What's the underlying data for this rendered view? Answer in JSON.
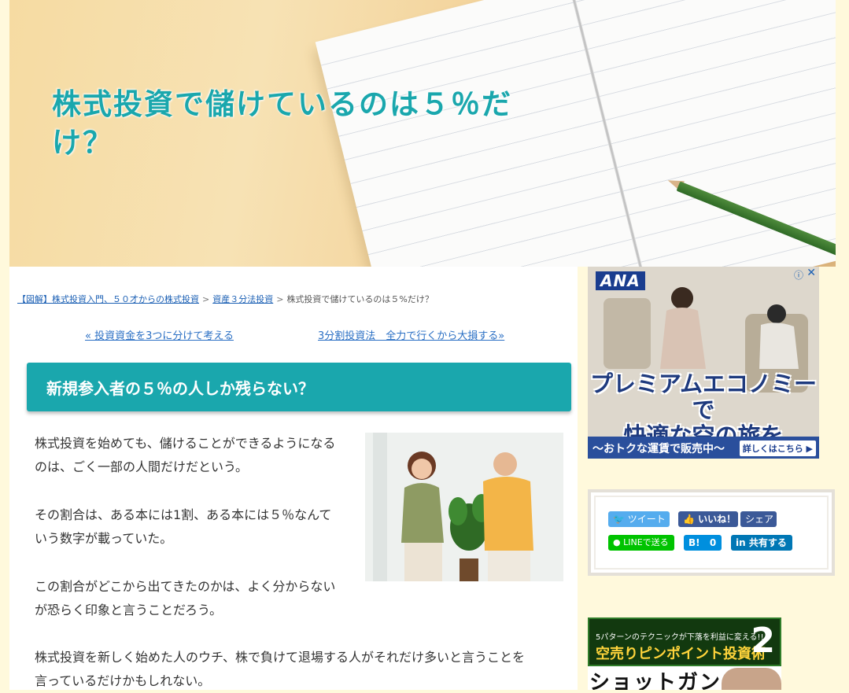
{
  "header": {
    "title": "株式投資で儲けているのは５％だけ？"
  },
  "breadcrumb": {
    "home": "【図解】株式投資入門、５０才からの株式投資",
    "category": "資産３分法投資",
    "current": "株式投資で儲けているのは５%だけ？",
    "sep": ">"
  },
  "post_nav": {
    "prev": "« 投資資金を3つに分けて考える",
    "next": "3分割投資法　全力で行くから大損する»"
  },
  "section": {
    "heading": "新規参入者の５％の人しか残らない？"
  },
  "paragraphs": [
    "株式投資を始めても、儲けることができるようになる",
    "のは、ごく一部の人間だけだという。",
    "その割合は、ある本には1割、ある本には５％なんて",
    "いう数字が載っていた。",
    "この割合がどこから出てきたのかは、よく分からない",
    "が恐らく印象と言うことだろう。",
    "株式投資を新しく始めた人のウチ、株で負けて退場する人がそれだけ多いと言うことを",
    "言っているだけかもしれない。"
  ],
  "ad": {
    "brand": "ANA",
    "info_icon": "ⓘ",
    "close_icon": "✕",
    "headline_1": "プレミアムエコノミーで",
    "headline_2": "快適な空の旅を",
    "strip_text": "〜おトクな運賃で販売中〜",
    "strip_button": "詳しくはこちら ▶"
  },
  "share": {
    "tweet": "ツイート",
    "like": "いいね！",
    "share": "シェア",
    "line": "LINEで送る",
    "hatena_icon": "B!",
    "hatena_count": "0",
    "linkedin": "共有する",
    "colors": {
      "twitter": "#55acee",
      "facebook": "#3b5998",
      "line": "#00c300",
      "hatena": "#008fde",
      "linkedin": "#0077b5"
    }
  },
  "banner": {
    "tagline": "5パターンのテクニックが下落を利益に変える!!",
    "title": "空売りピンポイント投資術",
    "number": "2",
    "subtitle": "ショットガン"
  }
}
